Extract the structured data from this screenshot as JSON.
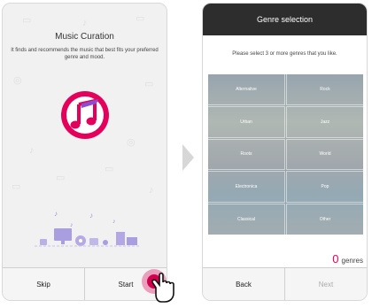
{
  "left_screen": {
    "title": "Music Curation",
    "description": "It finds and recommends the music that best fits your preferred genre and mood.",
    "skip_label": "Skip",
    "start_label": "Start"
  },
  "right_screen": {
    "header_title": "Genre selection",
    "instruction": "Please select 3 or more genres that you like.",
    "genres": [
      "Alternative",
      "Rock",
      "Urban",
      "Jazz",
      "Roots",
      "World",
      "Electronica",
      "Pop",
      "Classical",
      "Other"
    ],
    "selected_count": "0",
    "count_unit": "genres",
    "back_label": "Back",
    "next_label": "Next"
  },
  "colors": {
    "accent": "#e8005a",
    "header_bg": "#2d2d2d"
  }
}
